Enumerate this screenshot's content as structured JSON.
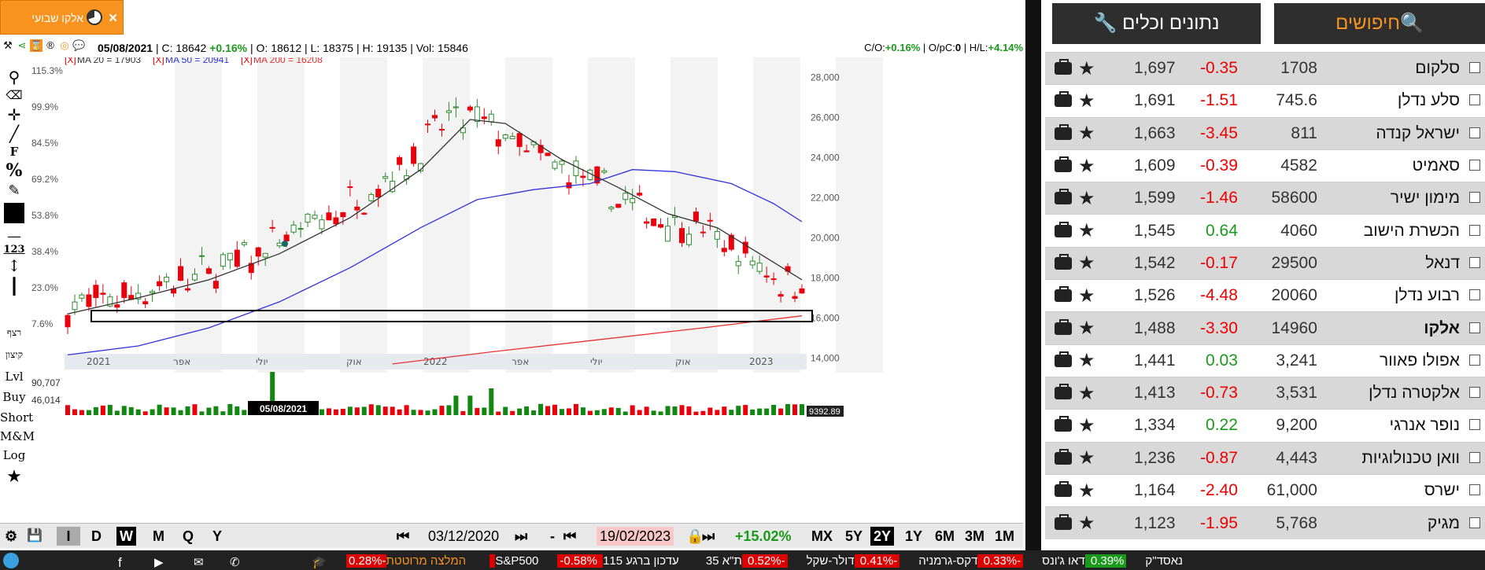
{
  "tab": {
    "title": "אלקו שבועי"
  },
  "info": {
    "date": "05/08/2021",
    "c_label": "C:",
    "c_value": "18642",
    "c_change": "+0.16%",
    "o_label": "O:",
    "o_value": "18612",
    "l_label": "L:",
    "l_value": "18375",
    "h_label": "H:",
    "h_value": "19135",
    "vol_label": "Vol:",
    "vol_value": "15846",
    "co_label": "C/O:",
    "co_value": "+0.16%",
    "opc_label": "O/pC:",
    "opc_value": "0",
    "hl_label": "H/L:",
    "hl_value": "+4.14%"
  },
  "ma": {
    "ma20": "MA 20 = 17903",
    "ma50": "MA 50 = 20941",
    "ma200": "MA 200 = 16208",
    "x": "[X]"
  },
  "tools": [
    "F",
    "%",
    "123",
    "רצף",
    "קיצון",
    "Lvl",
    "Buy",
    "Short",
    "M&M",
    "Log"
  ],
  "colors": {
    "up": "#2e8b2e",
    "down": "#e8000b",
    "ma20": "#333333",
    "ma50": "#3333dd",
    "ma200": "#e83030",
    "accent": "#f7931e"
  },
  "chart_data": {
    "type": "candlestick",
    "y_right_ticks": [
      "28,000",
      "26,000",
      "24,000",
      "22,000",
      "20,000",
      "18,000",
      "16,000",
      "14,000"
    ],
    "y_left_ticks": [
      "115.3%",
      "99.9%",
      "84.5%",
      "69.2%",
      "53.8%",
      "38.4%",
      "23.0%",
      "7.6%"
    ],
    "x_ticks": [
      "2021",
      "אפר",
      "יולי",
      "אוק",
      "2022",
      "אפר",
      "יולי",
      "אוק",
      "2023"
    ],
    "ylim": [
      13500,
      29000
    ],
    "volume_ticks": [
      "90,707",
      "46,014"
    ],
    "volume_last": "9392.89",
    "cursor_date": "05/08/2021",
    "ma20_points": [
      [
        0,
        16200
      ],
      [
        10,
        17000
      ],
      [
        20,
        17900
      ],
      [
        30,
        19200
      ],
      [
        40,
        21000
      ],
      [
        50,
        23400
      ],
      [
        57,
        25900
      ],
      [
        62,
        25700
      ],
      [
        70,
        23900
      ],
      [
        78,
        22500
      ],
      [
        85,
        21200
      ],
      [
        92,
        20500
      ],
      [
        98,
        19200
      ],
      [
        104,
        17900
      ]
    ],
    "ma50_points": [
      [
        0,
        14150
      ],
      [
        10,
        14600
      ],
      [
        20,
        15500
      ],
      [
        30,
        16800
      ],
      [
        40,
        18500
      ],
      [
        50,
        20500
      ],
      [
        58,
        21900
      ],
      [
        66,
        22400
      ],
      [
        74,
        22700
      ],
      [
        80,
        23400
      ],
      [
        86,
        23300
      ],
      [
        94,
        22700
      ],
      [
        100,
        21700
      ],
      [
        104,
        20800
      ]
    ],
    "ma200_points": [
      [
        46,
        13700
      ],
      [
        60,
        14300
      ],
      [
        75,
        14900
      ],
      [
        90,
        15500
      ],
      [
        104,
        16100
      ]
    ]
  },
  "bottom": {
    "start_date": "03/12/2020",
    "end_date": "19/02/2023",
    "period_change": "+15.02%",
    "freq": [
      "I",
      "D",
      "W",
      "M",
      "Q",
      "Y"
    ],
    "freq_active": "W",
    "ranges": [
      "MX",
      "5Y",
      "2Y",
      "1Y",
      "6M",
      "3M",
      "1M"
    ],
    "range_active": "2Y",
    "dash": "-"
  },
  "right": {
    "search_btn": "חיפושים",
    "tools_btn": "נתונים וכלים",
    "rows": [
      {
        "name": "סלקום",
        "price": "1708",
        "change": "-0.35",
        "vol": "1,697",
        "up": false
      },
      {
        "name": "סלע נדלן",
        "price": "745.6",
        "change": "-1.51",
        "vol": "1,691",
        "up": false
      },
      {
        "name": "ישראל קנדה",
        "price": "811",
        "change": "-3.45",
        "vol": "1,663",
        "up": false
      },
      {
        "name": "סאמיט",
        "price": "4582",
        "change": "-0.39",
        "vol": "1,609",
        "up": false
      },
      {
        "name": "מימון ישיר",
        "price": "58600",
        "change": "-1.46",
        "vol": "1,599",
        "up": false
      },
      {
        "name": "הכשרת הישוב",
        "price": "4060",
        "change": "0.64",
        "vol": "1,545",
        "up": true
      },
      {
        "name": "דנאל",
        "price": "29500",
        "change": "-0.17",
        "vol": "1,542",
        "up": false
      },
      {
        "name": "רבוע נדלן",
        "price": "20060",
        "change": "-4.48",
        "vol": "1,526",
        "up": false
      },
      {
        "name": "אלקו",
        "price": "14960",
        "change": "-3.30",
        "vol": "1,488",
        "up": false
      },
      {
        "name": "אפולו פאוור",
        "price": "3,241",
        "change": "0.03",
        "vol": "1,441",
        "up": true
      },
      {
        "name": "אלקטרה נדלן",
        "price": "3,531",
        "change": "-0.73",
        "vol": "1,413",
        "up": false
      },
      {
        "name": "נופר אנרגי",
        "price": "9,200",
        "change": "0.22",
        "vol": "1,334",
        "up": true
      },
      {
        "name": "וואן טכנולוגיות",
        "price": "4,443",
        "change": "-0.87",
        "vol": "1,236",
        "up": false
      },
      {
        "name": "ישרס",
        "price": "61,000",
        "change": "-2.40",
        "vol": "1,164",
        "up": false
      },
      {
        "name": "מגיק",
        "price": "5,768",
        "change": "-1.95",
        "vol": "1,123",
        "up": false
      }
    ]
  },
  "ticker": [
    {
      "label": "המלצה מרוטטת",
      "value": ""
    },
    {
      "label": "S&P500",
      "value": "-0.28%"
    },
    {
      "label": "נאסד\"ק",
      "value": "-0.58%"
    },
    {
      "label": "דאו ג'ונס",
      "value": "0.39%"
    },
    {
      "label": "דקס-גרמניה",
      "value": "-0.33%"
    },
    {
      "label": "דולר-שקל",
      "value": "-0.41%"
    },
    {
      "label": "ת\"א 35",
      "value": "-0.52%"
    },
    {
      "label": "עדכון ברגע 115",
      "value": ""
    }
  ]
}
